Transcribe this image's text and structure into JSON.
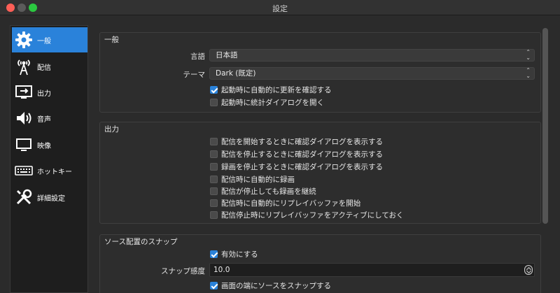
{
  "window": {
    "title": "設定"
  },
  "sidebar": {
    "items": [
      {
        "label": "一般",
        "icon": "gear-icon",
        "active": true
      },
      {
        "label": "配信",
        "icon": "antenna-icon",
        "active": false
      },
      {
        "label": "出力",
        "icon": "monitor-output-icon",
        "active": false
      },
      {
        "label": "音声",
        "icon": "speaker-icon",
        "active": false
      },
      {
        "label": "映像",
        "icon": "display-icon",
        "active": false
      },
      {
        "label": "ホットキー",
        "icon": "keyboard-icon",
        "active": false
      },
      {
        "label": "詳細設定",
        "icon": "tools-icon",
        "active": false
      }
    ]
  },
  "general": {
    "title": "一般",
    "language_label": "言語",
    "language_value": "日本語",
    "theme_label": "テーマ",
    "theme_value": "Dark (既定)",
    "checks": [
      {
        "label": "起動時に自動的に更新を確認する",
        "checked": true
      },
      {
        "label": "起動時に統計ダイアログを開く",
        "checked": false
      }
    ]
  },
  "output": {
    "title": "出力",
    "checks": [
      {
        "label": "配信を開始するときに確認ダイアログを表示する",
        "checked": false
      },
      {
        "label": "配信を停止するときに確認ダイアログを表示する",
        "checked": false
      },
      {
        "label": "録画を停止するときに確認ダイアログを表示する",
        "checked": false
      },
      {
        "label": "配信時に自動的に録画",
        "checked": false
      },
      {
        "label": "配信が停止しても録画を継続",
        "checked": false
      },
      {
        "label": "配信時に自動的にリプレイバッファを開始",
        "checked": false
      },
      {
        "label": "配信停止時にリプレイバッファをアクティブにしておく",
        "checked": false
      }
    ]
  },
  "snap": {
    "title": "ソース配置のスナップ",
    "enable_label": "有効にする",
    "enable_checked": true,
    "sensitivity_label": "スナップ感度",
    "sensitivity_value": "10.0",
    "screen_edge_label": "画面の端にソースをスナップする",
    "screen_edge_checked": true
  },
  "colors": {
    "accent": "#2a82da",
    "background": "#2b2b2b",
    "sidebar": "#1e1e1e"
  }
}
